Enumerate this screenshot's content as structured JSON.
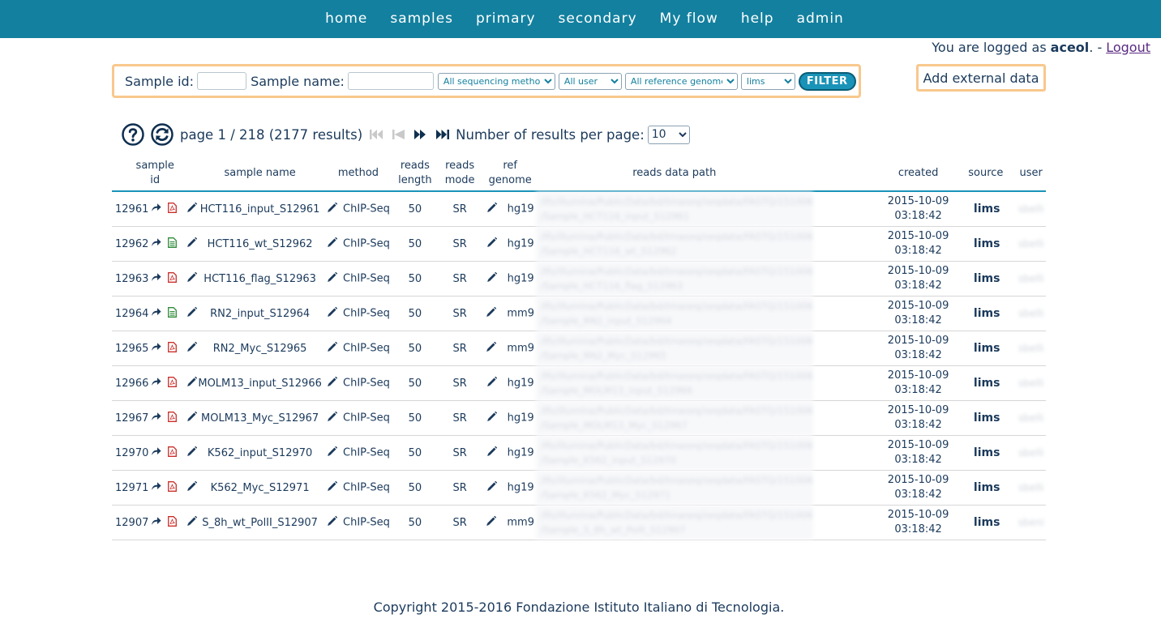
{
  "nav": {
    "links": [
      "home",
      "samples",
      "primary",
      "secondary",
      "My flow",
      "help",
      "admin"
    ]
  },
  "login": {
    "prefix": "You are logged as",
    "username": "aceol",
    "separator": ". -",
    "logout": "Logout"
  },
  "filter": {
    "sample_id_label": "Sample id:",
    "sample_name_label": "Sample name:",
    "method_select": "All sequencing method",
    "user_select": "All user",
    "genome_select": "All reference genomes",
    "source_select": "lims",
    "button": "FILTER"
  },
  "add_external_button": "Add external data",
  "pager": {
    "page_text": "page 1 / 218 (2177 results)",
    "per_page_label": "Number of results per page:",
    "per_page_value": "10"
  },
  "table": {
    "headers": {
      "sample_id": [
        "sample",
        "id"
      ],
      "sample_name": "sample name",
      "method": "method",
      "reads_length": [
        "reads",
        "length"
      ],
      "reads_mode": [
        "reads",
        "mode"
      ],
      "ref_genome": [
        "ref",
        "genome"
      ],
      "reads_data_path": "reads data path",
      "created": "created",
      "source": "source",
      "user": "user"
    },
    "rows": [
      {
        "id": "12961",
        "file": "pdf",
        "name": "HCT116_input_S12961",
        "method": "ChIP-Seq",
        "length": "50",
        "mode": "SR",
        "genome": "hg19",
        "path1": "/lfs/illumina/PublicData/bd/tmaseq/seqdata/FASTQ/151006",
        "path2": "/Sample_HCT116_input_S12961",
        "date": "2015-10-09",
        "time": "03:18:42",
        "source": "lims",
        "user": "sbelli"
      },
      {
        "id": "12962",
        "file": "doc",
        "name": "HCT116_wt_S12962",
        "method": "ChIP-Seq",
        "length": "50",
        "mode": "SR",
        "genome": "hg19",
        "path1": "/lfs/illumina/PublicData/bd/tmaseq/seqdata/FASTQ/151006",
        "path2": "/Sample_HCT116_wt_S12962",
        "date": "2015-10-09",
        "time": "03:18:42",
        "source": "lims",
        "user": "sbelli"
      },
      {
        "id": "12963",
        "file": "pdf",
        "name": "HCT116_flag_S12963",
        "method": "ChIP-Seq",
        "length": "50",
        "mode": "SR",
        "genome": "hg19",
        "path1": "/lfs/illumina/PublicData/bd/tmaseq/seqdata/FASTQ/151006",
        "path2": "/Sample_HCT116_flag_S12963",
        "date": "2015-10-09",
        "time": "03:18:42",
        "source": "lims",
        "user": "sbelli"
      },
      {
        "id": "12964",
        "file": "doc",
        "name": "RN2_input_S12964",
        "method": "ChIP-Seq",
        "length": "50",
        "mode": "SR",
        "genome": "mm9",
        "path1": "/lfs/illumina/PublicData/bd/tmaseq/seqdata/FASTQ/151006",
        "path2": "/Sample_RN2_input_S12964",
        "date": "2015-10-09",
        "time": "03:18:42",
        "source": "lims",
        "user": "sbelli"
      },
      {
        "id": "12965",
        "file": "pdf",
        "name": "RN2_Myc_S12965",
        "method": "ChIP-Seq",
        "length": "50",
        "mode": "SR",
        "genome": "mm9",
        "path1": "/lfs/illumina/PublicData/bd/tmaseq/seqdata/FASTQ/151006",
        "path2": "/Sample_RN2_Myc_S12965",
        "date": "2015-10-09",
        "time": "03:18:42",
        "source": "lims",
        "user": "sbelli"
      },
      {
        "id": "12966",
        "file": "pdf",
        "name": "MOLM13_input_S12966",
        "method": "ChIP-Seq",
        "length": "50",
        "mode": "SR",
        "genome": "hg19",
        "path1": "/lfs/illumina/PublicData/bd/tmaseq/seqdata/FASTQ/151006",
        "path2": "/Sample_MOLM13_input_S12966",
        "date": "2015-10-09",
        "time": "03:18:42",
        "source": "lims",
        "user": "sbelli"
      },
      {
        "id": "12967",
        "file": "pdf",
        "name": "MOLM13_Myc_S12967",
        "method": "ChIP-Seq",
        "length": "50",
        "mode": "SR",
        "genome": "hg19",
        "path1": "/lfs/illumina/PublicData/bd/tmaseq/seqdata/FASTQ/151006",
        "path2": "/Sample_MOLM13_Myc_S12967",
        "date": "2015-10-09",
        "time": "03:18:42",
        "source": "lims",
        "user": "sbelli"
      },
      {
        "id": "12970",
        "file": "pdf",
        "name": "K562_input_S12970",
        "method": "ChIP-Seq",
        "length": "50",
        "mode": "SR",
        "genome": "hg19",
        "path1": "/lfs/illumina/PublicData/bd/tmaseq/seqdata/FASTQ/151006",
        "path2": "/Sample_K562_input_S12970",
        "date": "2015-10-09",
        "time": "03:18:42",
        "source": "lims",
        "user": "sbelli"
      },
      {
        "id": "12971",
        "file": "pdf",
        "name": "K562_Myc_S12971",
        "method": "ChIP-Seq",
        "length": "50",
        "mode": "SR",
        "genome": "hg19",
        "path1": "/lfs/illumina/PublicData/bd/tmaseq/seqdata/FASTQ/151006",
        "path2": "/Sample_K562_Myc_S12971",
        "date": "2015-10-09",
        "time": "03:18:42",
        "source": "lims",
        "user": "sbelli"
      },
      {
        "id": "12907",
        "file": "pdf",
        "name": "S_8h_wt_PolII_S12907",
        "method": "ChIP-Seq",
        "length": "50",
        "mode": "SR",
        "genome": "mm9",
        "path1": "/lfs/illumina/PublicData/bd/tmaseq/seqdata/FASTQ/151006",
        "path2": "/Sample_S_8h_wt_PolII_S12907",
        "date": "2015-10-09",
        "time": "03:18:42",
        "source": "lims",
        "user": "sbeni"
      }
    ]
  },
  "footer": "Copyright 2015-2016 Fondazione Istituto Italiano di Tecnologia."
}
